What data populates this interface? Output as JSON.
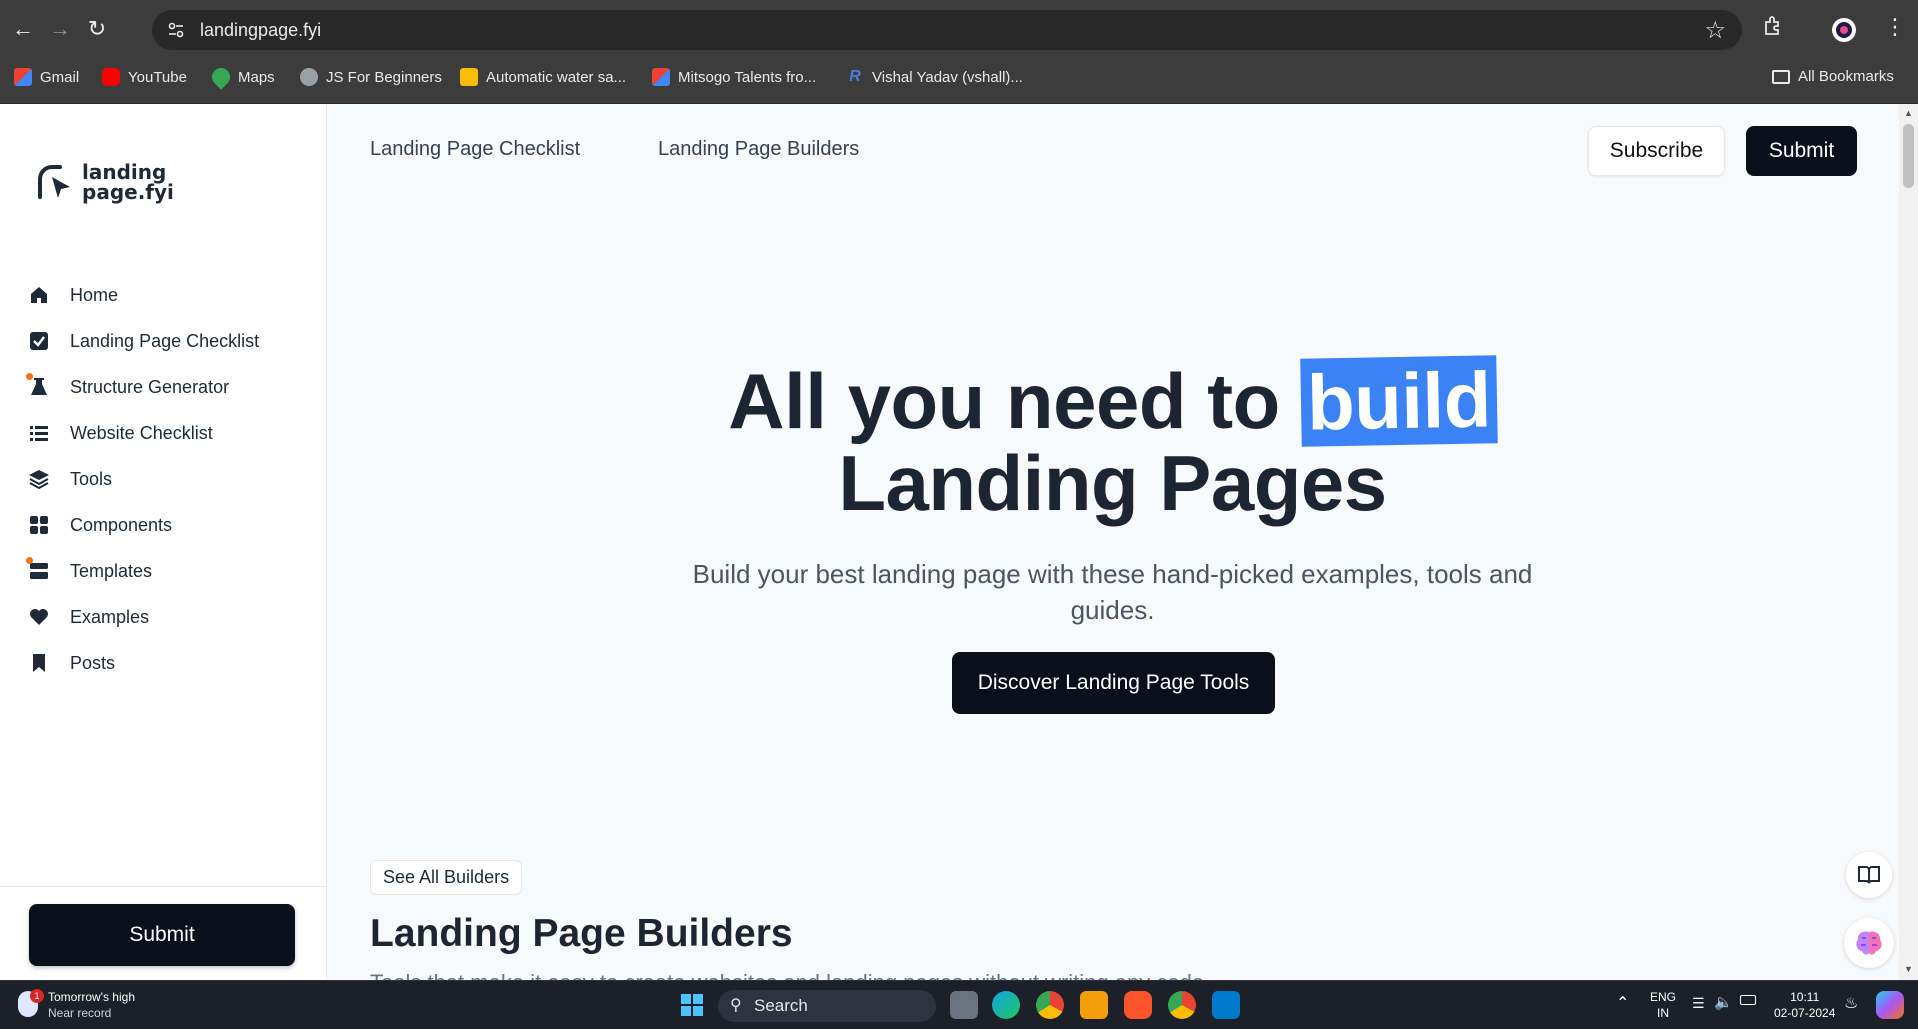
{
  "browser": {
    "url": "landingpage.fyi",
    "bookmarks": [
      "Gmail",
      "YouTube",
      "Maps",
      "JS For Beginners",
      "Automatic water sa...",
      "Mitsogo Talents fro...",
      "Vishal Yadav (vshall)..."
    ],
    "all_bookmarks": "All Bookmarks"
  },
  "sidebar": {
    "logo_line1": "landing",
    "logo_line2": "page.fyi",
    "items": [
      {
        "label": "Home",
        "icon": "home-icon"
      },
      {
        "label": "Landing Page Checklist",
        "icon": "checkbox-icon"
      },
      {
        "label": "Structure Generator",
        "icon": "flask-icon"
      },
      {
        "label": "Website Checklist",
        "icon": "list-icon"
      },
      {
        "label": "Tools",
        "icon": "layers-icon"
      },
      {
        "label": "Components",
        "icon": "grid-icon"
      },
      {
        "label": "Templates",
        "icon": "templates-icon"
      },
      {
        "label": "Examples",
        "icon": "heart-icon"
      },
      {
        "label": "Posts",
        "icon": "bookmark-icon"
      }
    ],
    "submit_label": "Submit"
  },
  "topnav": {
    "link1": "Landing Page Checklist",
    "link2": "Landing Page Builders",
    "subscribe": "Subscribe",
    "submit": "Submit"
  },
  "hero": {
    "title_prefix": "All you need to ",
    "title_highlight": "build",
    "title_line2": "Landing Pages",
    "subtitle": "Build your best landing page with these hand-picked examples, tools and guides.",
    "cta": "Discover Landing Page Tools"
  },
  "section": {
    "see_all": "See All Builders",
    "heading": "Landing Page Builders",
    "description": "Tools that make it easy to create websites and landing pages without writing any code."
  },
  "taskbar": {
    "weather_title": "Tomorrow's high",
    "weather_sub": "Near record",
    "search_label": "Search",
    "lang_line1": "ENG",
    "lang_line2": "IN",
    "time": "10:11",
    "date": "02-07-2024"
  },
  "colors": {
    "accent": "#3b82f6",
    "dark_button": "#0b0f1a",
    "heading": "#1e2532"
  }
}
